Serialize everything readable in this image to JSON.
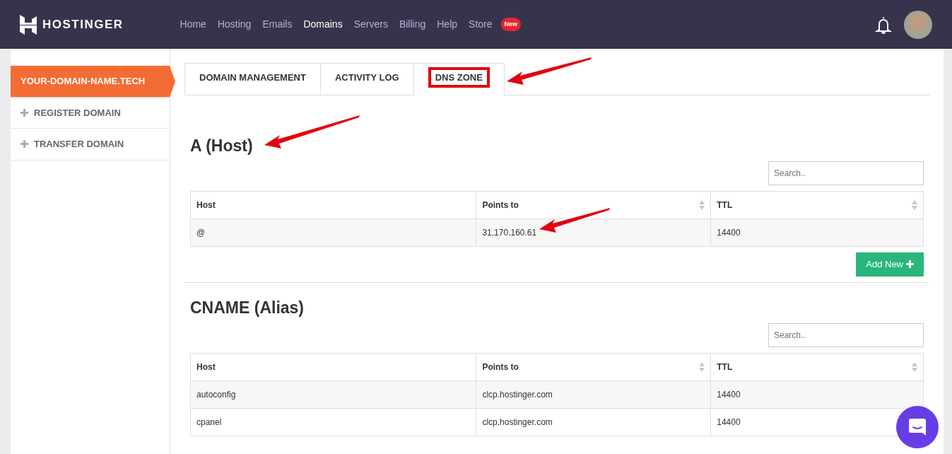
{
  "brand": "HOSTINGER",
  "nav": [
    {
      "label": "Home",
      "selected": false
    },
    {
      "label": "Hosting",
      "selected": false
    },
    {
      "label": "Emails",
      "selected": false
    },
    {
      "label": "Domains",
      "selected": true
    },
    {
      "label": "Servers",
      "selected": false
    },
    {
      "label": "Billing",
      "selected": false
    },
    {
      "label": "Help",
      "selected": false
    },
    {
      "label": "Store",
      "selected": false,
      "badge": "New"
    }
  ],
  "sidebar": [
    {
      "label": "YOUR-DOMAIN-NAME.TECH",
      "kind": "domain",
      "selected": true
    },
    {
      "label": "REGISTER DOMAIN",
      "kind": "action",
      "selected": false
    },
    {
      "label": "TRANSFER DOMAIN",
      "kind": "action",
      "selected": false
    }
  ],
  "tabs": [
    {
      "label": "DOMAIN MANAGEMENT",
      "selected": false,
      "highlighted": false,
      "arrow": false
    },
    {
      "label": "ACTIVITY LOG",
      "selected": false,
      "highlighted": false,
      "arrow": false
    },
    {
      "label": "DNS ZONE",
      "selected": true,
      "highlighted": true,
      "arrow": true
    }
  ],
  "sections": [
    {
      "title": "A (Host)",
      "arrow": true,
      "search_placeholder": "Search..",
      "columns": [
        {
          "label": "Host",
          "sortable": false
        },
        {
          "label": "Points to",
          "sortable": true
        },
        {
          "label": "TTL",
          "sortable": true
        }
      ],
      "rows": [
        {
          "cells": [
            {
              "text": "@",
              "arrow": false
            },
            {
              "text": "31.170.160.61",
              "arrow": true
            },
            {
              "text": "14400",
              "arrow": false
            }
          ]
        }
      ],
      "add_button": "Add New"
    },
    {
      "title": "CNAME (Alias)",
      "arrow": false,
      "search_placeholder": "Search..",
      "columns": [
        {
          "label": "Host",
          "sortable": false
        },
        {
          "label": "Points to",
          "sortable": true
        },
        {
          "label": "TTL",
          "sortable": true
        }
      ],
      "rows": [
        {
          "cells": [
            {
              "text": "autoconfig",
              "arrow": false
            },
            {
              "text": "clcp.hostinger.com",
              "arrow": false
            },
            {
              "text": "14400",
              "arrow": false
            }
          ]
        },
        {
          "cells": [
            {
              "text": "cpanel",
              "arrow": false
            },
            {
              "text": "clcp.hostinger.com",
              "arrow": false
            },
            {
              "text": "14400",
              "arrow": false
            }
          ]
        }
      ]
    }
  ]
}
